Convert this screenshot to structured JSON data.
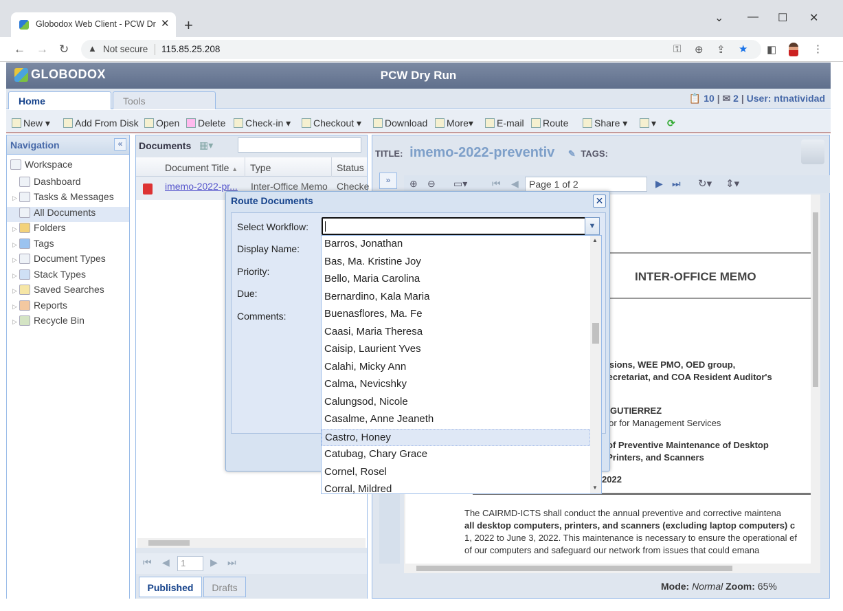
{
  "browser": {
    "tab_title": "Globodox Web Client - PCW Dry Run",
    "new_tab": "+",
    "min": "—",
    "max": "☐",
    "close": "✕",
    "not_secure": "Not secure",
    "url": "115.85.25.208"
  },
  "app": {
    "logo": "GLOBODOX",
    "title": "PCW Dry Run",
    "tabs": [
      "Home",
      "Tools"
    ],
    "user": {
      "tasks": "10",
      "messages": "2",
      "separator": "|",
      "user_label": "User: ntnatividad"
    },
    "toolbar": [
      "New",
      "Add From Disk",
      "Open",
      "Delete",
      "Check-in",
      "Checkout",
      "Download",
      "More",
      "E-mail",
      "Route",
      "Share"
    ]
  },
  "navigation": {
    "title": "Navigation",
    "collapse": "«",
    "items": [
      {
        "label": "Workspace",
        "level": 0
      },
      {
        "label": "Dashboard",
        "level": 1
      },
      {
        "label": "Tasks & Messages",
        "level": 1
      },
      {
        "label": "All Documents",
        "level": 1
      },
      {
        "label": "Folders",
        "level": 1
      },
      {
        "label": "Tags",
        "level": 1
      },
      {
        "label": "Document Types",
        "level": 1
      },
      {
        "label": "Stack Types",
        "level": 1
      },
      {
        "label": "Saved Searches",
        "level": 1
      },
      {
        "label": "Reports",
        "level": 1
      },
      {
        "label": "Recycle Bin",
        "level": 1
      }
    ]
  },
  "documents": {
    "title": "Documents",
    "columns": [
      "Document Title",
      "Type",
      "Status"
    ],
    "row": {
      "title": "imemo-2022-pr...",
      "type": "Inter-Office Memo",
      "status": "Checke"
    },
    "pager_page": "1",
    "tabs": [
      "Published",
      "Drafts"
    ]
  },
  "viewer": {
    "title_label": "TITLE:",
    "doc_title": "imemo-2022-preventiv",
    "tags_label": "TAGS:",
    "page_display": "Page 1 of 2",
    "memo": {
      "heading": "INTER-OFFICE MEMO",
      "line1": "visions, WEE PMO, OED group,",
      "line2": "Secretariat, and COA Resident Auditor's",
      "from1": "GUTIERREZ",
      "from2": "ctor for Management Services",
      "subj1": "of Preventive Maintenance of Desktop",
      "subj2": ",  Printers, and Scanners",
      "date": "2022",
      "p1": "The CAIRMD-ICTS shall conduct the annual preventive and corrective maintena",
      "p2": "all desktop computers, printers, and scanners (excluding laptop computers) c",
      "p3": "1, 2022 to June 3, 2022. This maintenance is necessary to ensure the operational ef",
      "p4": "of our computers and safeguard our network from issues that could emana"
    },
    "mode_label": "Mode:",
    "mode": "Normal",
    "zoom_label": "Zoom:",
    "zoom": "65%"
  },
  "dialog": {
    "title": "Route Documents",
    "close": "✕",
    "fields": [
      "Select Workflow:",
      "Display Name:",
      "Priority:",
      "Due:",
      "Comments:"
    ],
    "workflow_value": "",
    "options": [
      "Barros, Jonathan",
      "Bas, Ma. Kristine Joy",
      "Bello, Maria Carolina",
      "Bernardino, Kala Maria",
      "Buenasflores, Ma. Fe",
      "Caasi, Maria Theresa",
      "Caisip, Laurient Yves",
      "Calahi, Micky Ann",
      "Calma, Nevicshky",
      "Calungsod, Nicole",
      "Casalme, Anne Jeaneth",
      "Castro, Honey",
      "Catubag, Chary Grace",
      "Cornel, Rosel",
      "Corral, Mildred"
    ],
    "highlighted": "Castro, Honey"
  }
}
